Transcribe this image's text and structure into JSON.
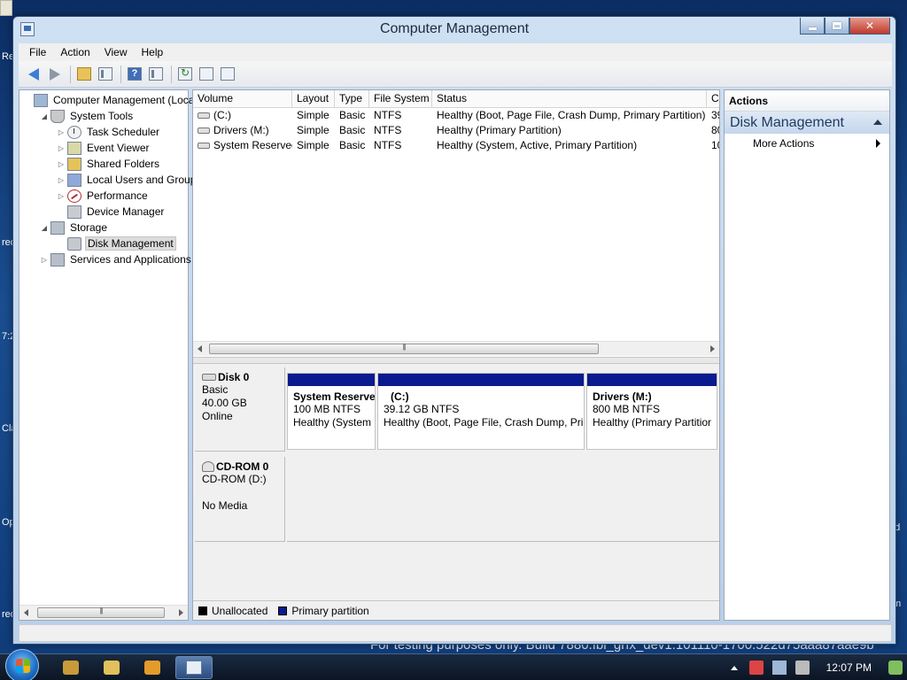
{
  "window": {
    "title": "Computer Management"
  },
  "menu": [
    "File",
    "Action",
    "View",
    "Help"
  ],
  "tree": {
    "items": [
      {
        "label": "Computer Management (Local",
        "depth": 0,
        "expander": "",
        "icon": "computer-icon"
      },
      {
        "label": "System Tools",
        "depth": 1,
        "expander": "◢",
        "icon": "tools-icon"
      },
      {
        "label": "Task Scheduler",
        "depth": 2,
        "expander": "▷",
        "icon": "clock-icon"
      },
      {
        "label": "Event Viewer",
        "depth": 2,
        "expander": "▷",
        "icon": "event-viewer-icon"
      },
      {
        "label": "Shared Folders",
        "depth": 2,
        "expander": "▷",
        "icon": "shared-folder-icon"
      },
      {
        "label": "Local Users and Groups",
        "depth": 2,
        "expander": "▷",
        "icon": "users-icon"
      },
      {
        "label": "Performance",
        "depth": 2,
        "expander": "▷",
        "icon": "performance-icon"
      },
      {
        "label": "Device Manager",
        "depth": 2,
        "expander": "",
        "icon": "device-manager-icon"
      },
      {
        "label": "Storage",
        "depth": 1,
        "expander": "◢",
        "icon": "storage-icon"
      },
      {
        "label": "Disk Management",
        "depth": 2,
        "expander": "",
        "icon": "disk-icon",
        "selected": true
      },
      {
        "label": "Services and Applications",
        "depth": 1,
        "expander": "▷",
        "icon": "services-icon"
      }
    ]
  },
  "volumes": {
    "columns": [
      "Volume",
      "Layout",
      "Type",
      "File System",
      "Status",
      "C"
    ],
    "rows": [
      {
        "volume": "(C:)",
        "layout": "Simple",
        "type": "Basic",
        "fs": "NTFS",
        "status": "Healthy (Boot, Page File, Crash Dump, Primary Partition)",
        "cap": "39"
      },
      {
        "volume": "Drivers (M:)",
        "layout": "Simple",
        "type": "Basic",
        "fs": "NTFS",
        "status": "Healthy (Primary Partition)",
        "cap": "80"
      },
      {
        "volume": "System Reserved",
        "layout": "Simple",
        "type": "Basic",
        "fs": "NTFS",
        "status": "Healthy (System, Active, Primary Partition)",
        "cap": "10"
      }
    ]
  },
  "disks": {
    "disk0": {
      "name": "Disk 0",
      "type": "Basic",
      "size": "40.00 GB",
      "state": "Online",
      "partitions": [
        {
          "name": "System Reserve",
          "size": "100 MB NTFS",
          "status": "Healthy (System"
        },
        {
          "name": "(C:)",
          "size": "39.12 GB NTFS",
          "status": "Healthy (Boot, Page File, Crash Dump, Pri"
        },
        {
          "name": "Drivers  (M:)",
          "size": "800 MB NTFS",
          "status": "Healthy (Primary Partitior"
        }
      ]
    },
    "cdrom0": {
      "name": "CD-ROM 0",
      "drive": "CD-ROM (D:)",
      "media": "No Media"
    }
  },
  "legend": {
    "unallocated": "Unallocated",
    "primary": "Primary partition",
    "unallocated_color": "#000000",
    "primary_color": "#0a1a8f"
  },
  "actions": {
    "header": "Actions",
    "section": "Disk Management",
    "more": "More Actions"
  },
  "taskbar": {
    "clock": "12:07 PM"
  },
  "desktop": {
    "watermark": "For testing purposes only. Build 7880.fbl_grfx_dev1.101110-1700.522d75aaa87aae9b",
    "fragments": [
      "Re",
      "red",
      "7:2",
      "Cla",
      "Op",
      "red",
      "nd",
      "m"
    ]
  }
}
